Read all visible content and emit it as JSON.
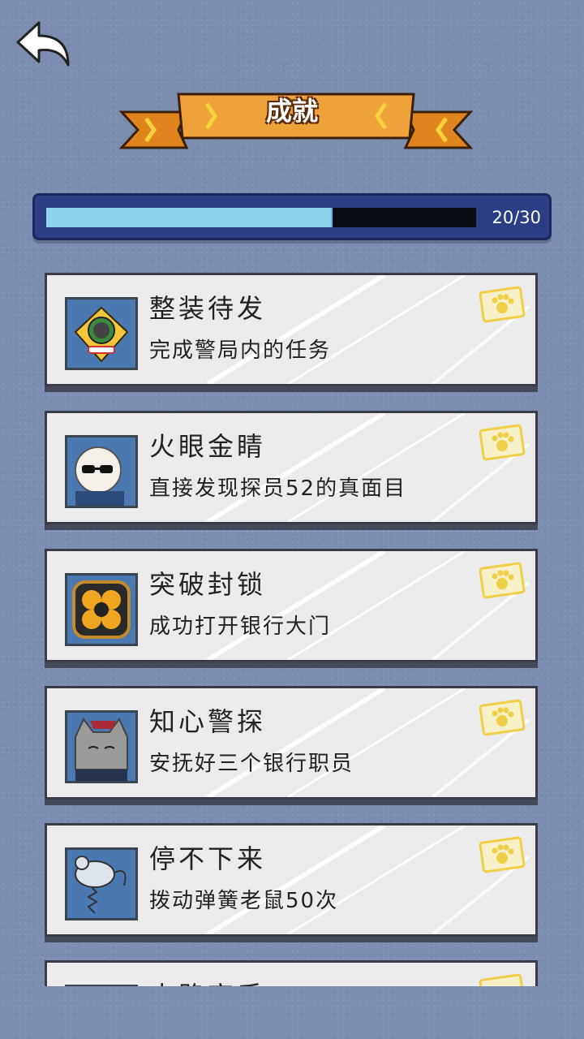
{
  "header": {
    "back_icon": "back-arrow-icon",
    "title": "成就"
  },
  "progress": {
    "text": "20/30",
    "value": 20,
    "max": 30,
    "fill_color": "#8fd4ef"
  },
  "achievements": [
    {
      "title": "整装待发",
      "desc": "完成警局内的任务",
      "icon": "police-badge-icon"
    },
    {
      "title": "火眼金睛",
      "desc": "直接发现探员52的真面目",
      "icon": "sunglasses-agent-icon"
    },
    {
      "title": "突破封锁",
      "desc": "成功打开银行大门",
      "icon": "bank-door-lock-icon"
    },
    {
      "title": "知心警探",
      "desc": "安抚好三个银行职员",
      "icon": "cat-clerk-icon"
    },
    {
      "title": "停不下来",
      "desc": "拨动弹簧老鼠50次",
      "icon": "spring-mouse-toy-icon"
    },
    {
      "title": "电路高手",
      "desc": "",
      "icon": "circuit-icon"
    }
  ],
  "stamp_icon": "paw-stamp-icon",
  "colors": {
    "background": "#7d8db0",
    "banner": "#f0a23a",
    "card": "#ebebeb",
    "progress_frame": "#2b3d84"
  }
}
